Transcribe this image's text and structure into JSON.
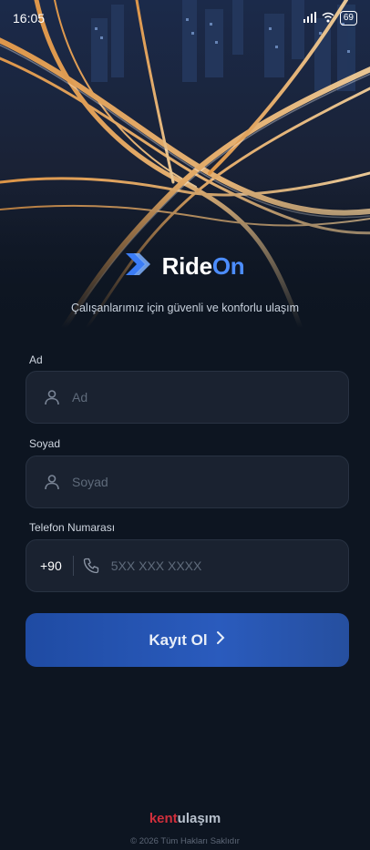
{
  "status_bar": {
    "time": "16:05",
    "indicators": [
      "signal-icon",
      "wifi-icon"
    ],
    "battery": "69"
  },
  "brand": {
    "name_part1": "Ride",
    "name_part2": "On",
    "logo_icon": "double-chevron-icon",
    "accent_color": "#4c8dff"
  },
  "tagline": "Çalışanlarımız için güvenli ve konforlu ulaşım",
  "form": {
    "first_name": {
      "label": "Ad",
      "placeholder": "Ad",
      "icon": "user-icon",
      "value": ""
    },
    "last_name": {
      "label": "Soyad",
      "placeholder": "Soyad",
      "icon": "user-icon",
      "value": ""
    },
    "phone": {
      "label": "Telefon Numarası",
      "country_code": "+90",
      "placeholder": "5XX XXX XXXX",
      "icon": "phone-icon",
      "value": ""
    },
    "submit_label": "Kayıt Ol",
    "submit_icon": "chevron-right-icon"
  },
  "footer": {
    "brand_part1": "kent",
    "brand_part2": "ulaşım",
    "brand_color": "#d12f3c",
    "copyright": "© 2026 Tüm Hakları Saklıdır"
  }
}
